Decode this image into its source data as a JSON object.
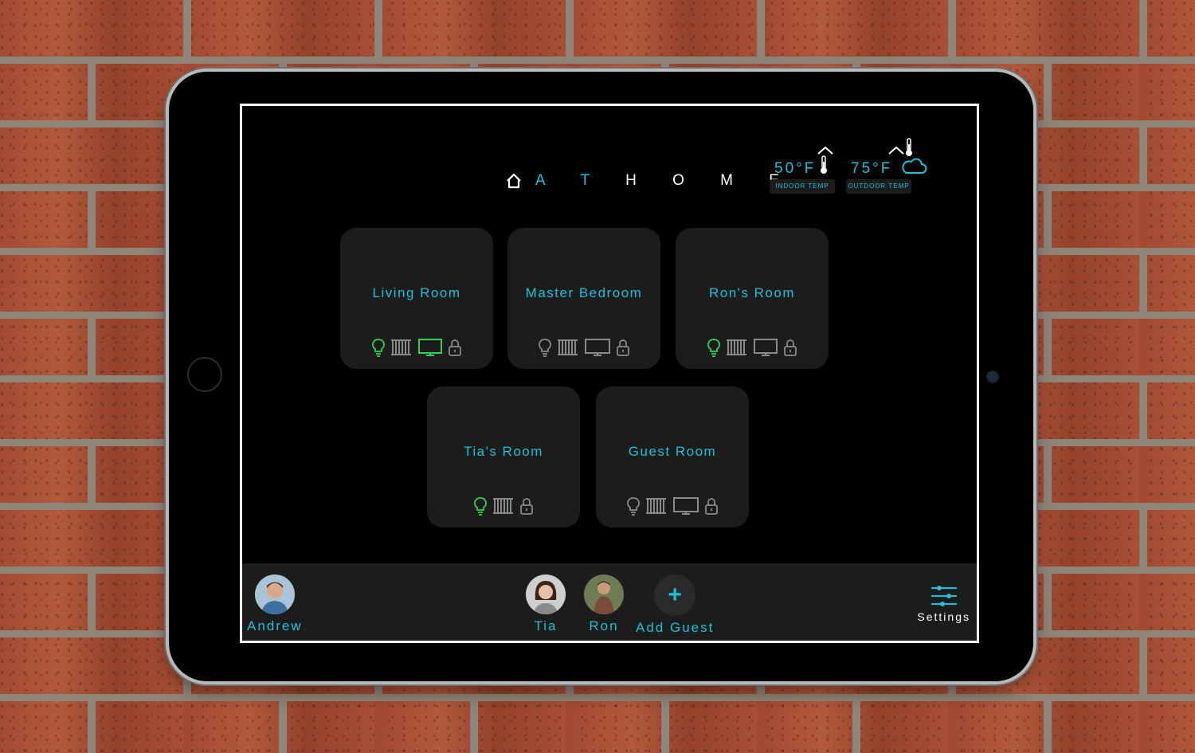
{
  "header": {
    "title_first": "A T",
    "title_second": "H O M E"
  },
  "temps": {
    "indoor": {
      "value": "50°F",
      "label": "INDOOR TEMP"
    },
    "outdoor": {
      "value": "75°F",
      "label": "OUTDOOR TEMP"
    }
  },
  "rooms": [
    {
      "name": "Living Room"
    },
    {
      "name": "Master Bedroom"
    },
    {
      "name": "Ron's Room"
    },
    {
      "name": "Tia's Room"
    },
    {
      "name": "Guest Room"
    }
  ],
  "people": {
    "main_user": "Andrew",
    "members": [
      "Tia",
      "Ron"
    ],
    "add_guest": "Add Guest"
  },
  "settings": {
    "label": "Settings"
  },
  "colors": {
    "accent": "#19c3d8",
    "active_green": "#2fd05a",
    "inactive_gray": "#8a8a8a",
    "card_bg": "#1c1c1c"
  }
}
